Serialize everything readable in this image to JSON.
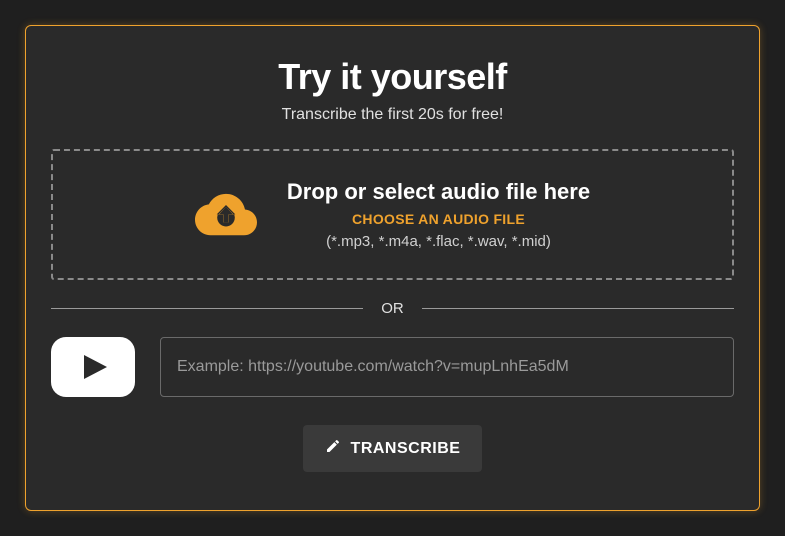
{
  "header": {
    "title": "Try it yourself",
    "subtitle": "Transcribe the first 20s for free!"
  },
  "dropzone": {
    "title": "Drop or select audio file here",
    "choose_label": "CHOOSE AN AUDIO FILE",
    "formats": "(*.mp3, *.m4a, *.flac, *.wav, *.mid)"
  },
  "divider": {
    "label": "OR"
  },
  "youtube": {
    "placeholder": "Example: https://youtube.com/watch?v=mupLnhEa5dM"
  },
  "transcribe": {
    "label": "TRANSCRIBE"
  },
  "colors": {
    "accent": "#efa22d"
  }
}
